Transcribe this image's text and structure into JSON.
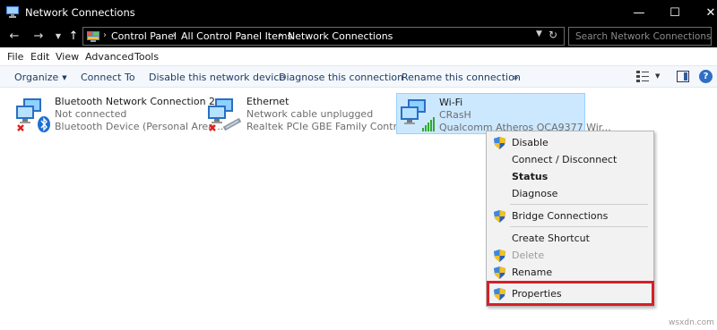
{
  "window": {
    "title": "Network Connections",
    "controls": {
      "minimize": "—",
      "maximize": "☐",
      "close": "✕"
    }
  },
  "address_bar": {
    "breadcrumbs": [
      "Control Panel",
      "All Control Panel Items",
      "Network Connections"
    ],
    "search_placeholder": "Search Network Connections"
  },
  "menu": [
    "File",
    "Edit",
    "View",
    "Advanced",
    "Tools"
  ],
  "commands": {
    "organize": "Organize",
    "connect_to": "Connect To",
    "disable": "Disable this network device",
    "diagnose": "Diagnose this connection",
    "rename": "Rename this connection",
    "more": "»"
  },
  "connections": [
    {
      "name": "Bluetooth Network Connection 2",
      "status": "Not connected",
      "device": "Bluetooth Device (Personal Area ...",
      "icon": "bluetooth-network-icon"
    },
    {
      "name": "Ethernet",
      "status": "Network cable unplugged",
      "device": "Realtek PCIe GBE Family Controller",
      "icon": "ethernet-network-icon"
    },
    {
      "name": "Wi-Fi",
      "status": "CRasH",
      "device": "Qualcomm Atheros QCA9377 Wir...",
      "icon": "wifi-network-icon"
    }
  ],
  "context_menu": {
    "disable": "Disable",
    "connect_disconnect": "Connect / Disconnect",
    "status": "Status",
    "diagnose": "Diagnose",
    "bridge": "Bridge Connections",
    "create_shortcut": "Create Shortcut",
    "delete": "Delete",
    "rename": "Rename",
    "properties": "Properties"
  },
  "watermark": "wsxdn.com",
  "colors": {
    "accent_highlight": "#d71f27",
    "selection_bg": "#cce8ff",
    "titlebar_bg": "#000000"
  }
}
